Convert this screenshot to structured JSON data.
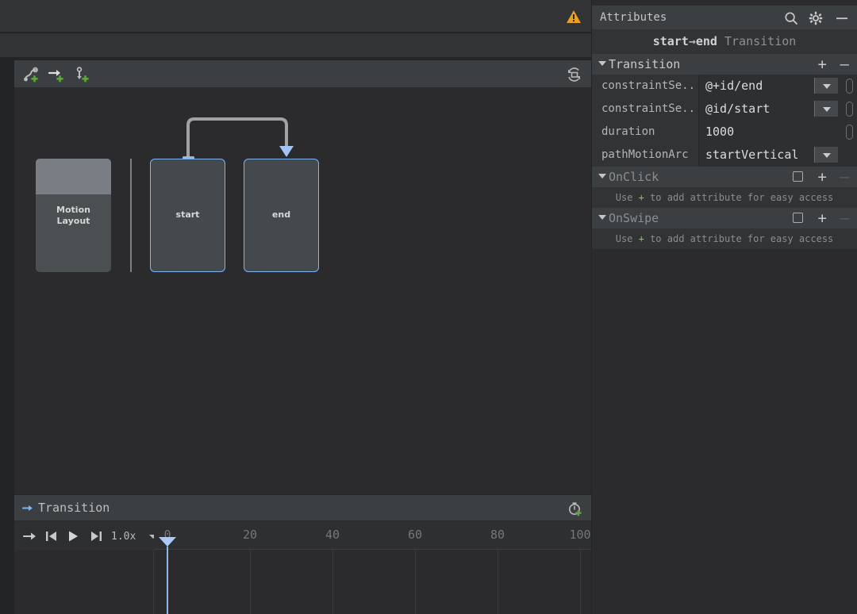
{
  "editor": {
    "toolbar_icons": [
      {
        "name": "add-keyframe-icon",
        "glyph": "motion-path-plus"
      },
      {
        "name": "add-transition-icon",
        "glyph": "arrow-plus"
      },
      {
        "name": "add-constraintset-icon",
        "glyph": "pin-plus"
      }
    ],
    "warning_icon": "warning-triangle-icon",
    "help_icon": "help-circle-icon",
    "sync_icon": "sync-refresh-icon",
    "preview": {
      "motion_layout_label_line1": "Motion",
      "motion_layout_label_line2": "Layout",
      "states": [
        {
          "id": "start",
          "label": "start"
        },
        {
          "id": "end",
          "label": "end"
        }
      ]
    }
  },
  "timeline": {
    "header_title": "Transition",
    "header_arrow_icon": "transition-arrow-icon",
    "add_keyframe_icon": "stopwatch-plus-icon",
    "controls": {
      "goto_icon": "jump-to-end-icon",
      "first_icon": "skip-to-start-icon",
      "play_icon": "play-icon",
      "last_icon": "skip-to-end-icon",
      "speed_label": "1.0x"
    },
    "ruler_ticks": [
      0,
      20,
      40,
      60,
      80,
      100
    ],
    "playhead_value": 0
  },
  "attributes": {
    "panel_title": "Attributes",
    "search_icon": "search-icon",
    "settings_icon": "gear-icon",
    "minimize_icon": "minimize-icon",
    "subtitle": {
      "from": "start",
      "arrow": "→",
      "to": "end",
      "kind": "Transition"
    },
    "sections": [
      {
        "name": "Transition",
        "accent": "#c8cacc",
        "has_checkbox": false,
        "add_label": "+",
        "remove_label": "—",
        "remove_enabled": true,
        "rows": [
          {
            "key": "constraintSe...",
            "value": "@+id/end",
            "dropdown": true,
            "pill": true
          },
          {
            "key": "constraintSe...",
            "value": "@id/start",
            "dropdown": true,
            "pill": true
          },
          {
            "key": "duration",
            "value": "1000",
            "dropdown": false,
            "pill": true
          },
          {
            "key": "pathMotionArc",
            "value": "startVertical",
            "dropdown": true,
            "pill": false
          }
        ]
      },
      {
        "name": "OnClick",
        "accent": "#8b8e90",
        "has_checkbox": true,
        "add_label": "+",
        "remove_label": "—",
        "remove_enabled": false,
        "hint_pre": "Use ",
        "hint_plus": "+",
        "hint_post": " to add attribute for easy access",
        "rows": []
      },
      {
        "name": "OnSwipe",
        "accent": "#8b8e90",
        "has_checkbox": true,
        "add_label": "+",
        "remove_label": "—",
        "remove_enabled": false,
        "hint_pre": "Use ",
        "hint_plus": "+",
        "hint_post": " to add attribute for easy access",
        "rows": []
      }
    ]
  },
  "colors": {
    "accent_blue": "#7fb2f0",
    "warning_amber": "#e8a020",
    "plus_green": "#5fa544",
    "panel_bg": "#2b2b2d",
    "header_bg": "#3c3f41"
  }
}
